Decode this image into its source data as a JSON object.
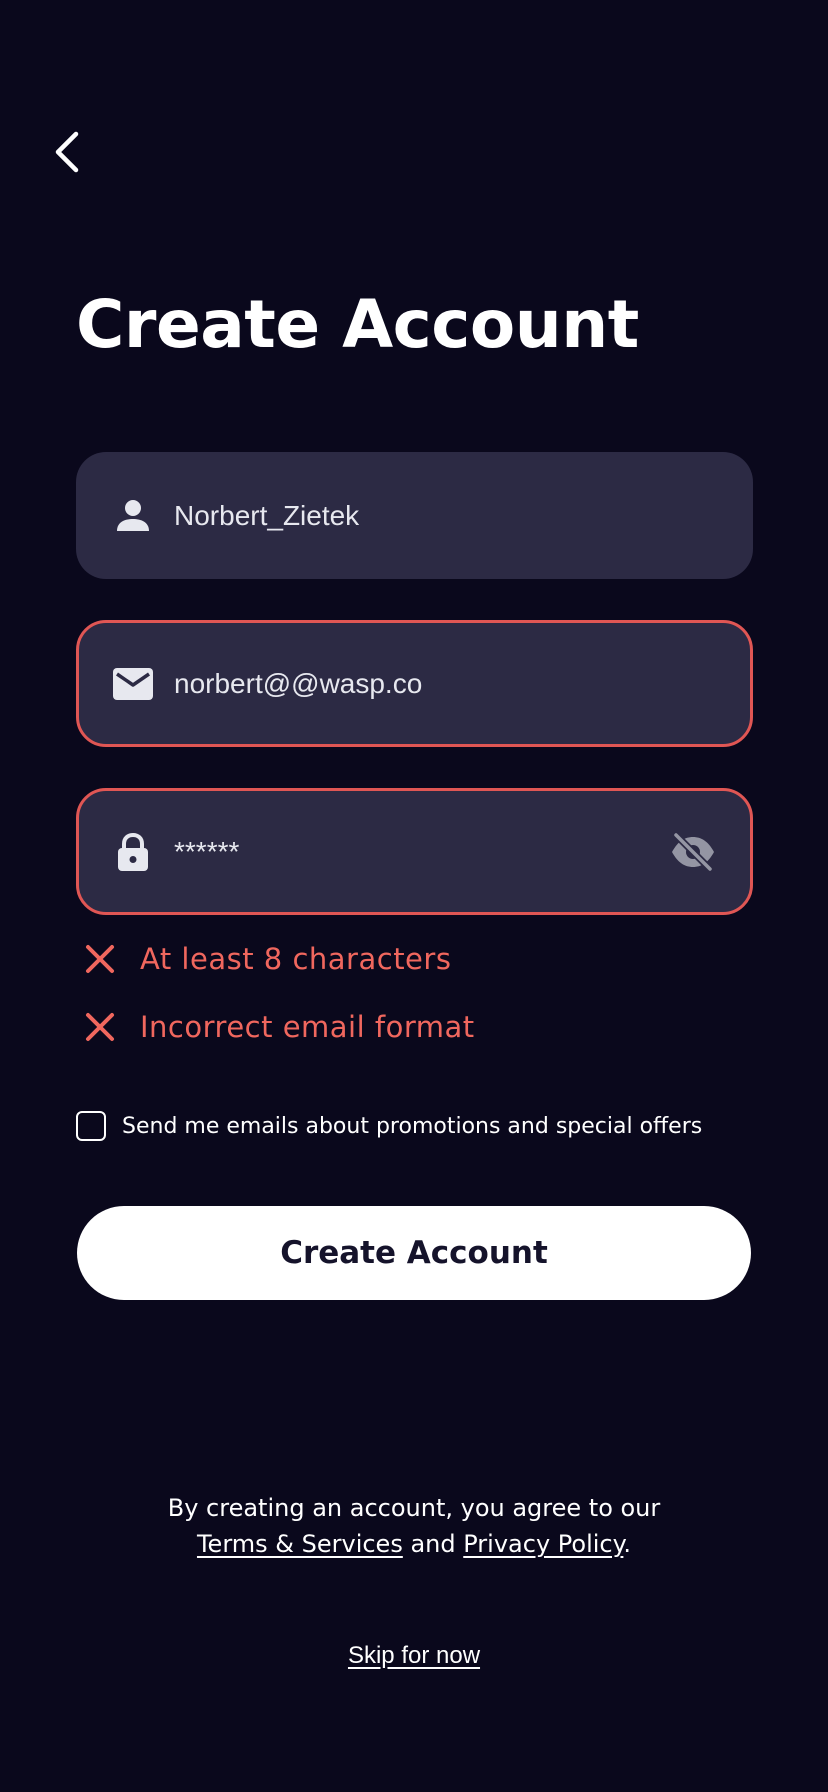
{
  "header": {
    "back_icon": "chevron-left-icon",
    "title": "Create Account"
  },
  "form": {
    "username": {
      "icon": "user-icon",
      "value": "Norbert_Zietek",
      "state": "valid"
    },
    "email": {
      "icon": "mail-icon",
      "value": "norbert@@wasp.co",
      "state": "error"
    },
    "password": {
      "icon": "lock-icon",
      "value": "******",
      "toggle_icon": "eye-off-icon",
      "state": "error"
    },
    "errors": [
      {
        "icon": "x-icon",
        "text": "At least 8 characters"
      },
      {
        "icon": "x-icon",
        "text": "Incorrect email format"
      }
    ],
    "promo_opt_in": {
      "checked": false,
      "label": "Send me emails about promotions and special offers"
    },
    "submit_label": "Create Account"
  },
  "legal": {
    "line1": "By creating an account, you agree to our",
    "terms_label": "Terms & Services",
    "and_text": " and ",
    "privacy_label": "Privacy Policy",
    "period": "."
  },
  "skip_label": "Skip for now",
  "colors": {
    "background": "#0a081c",
    "field_bg": "#2c2a44",
    "error": "#e05654",
    "error_text": "#f0675e",
    "button_bg": "#ffffff",
    "button_text": "#15132b"
  }
}
